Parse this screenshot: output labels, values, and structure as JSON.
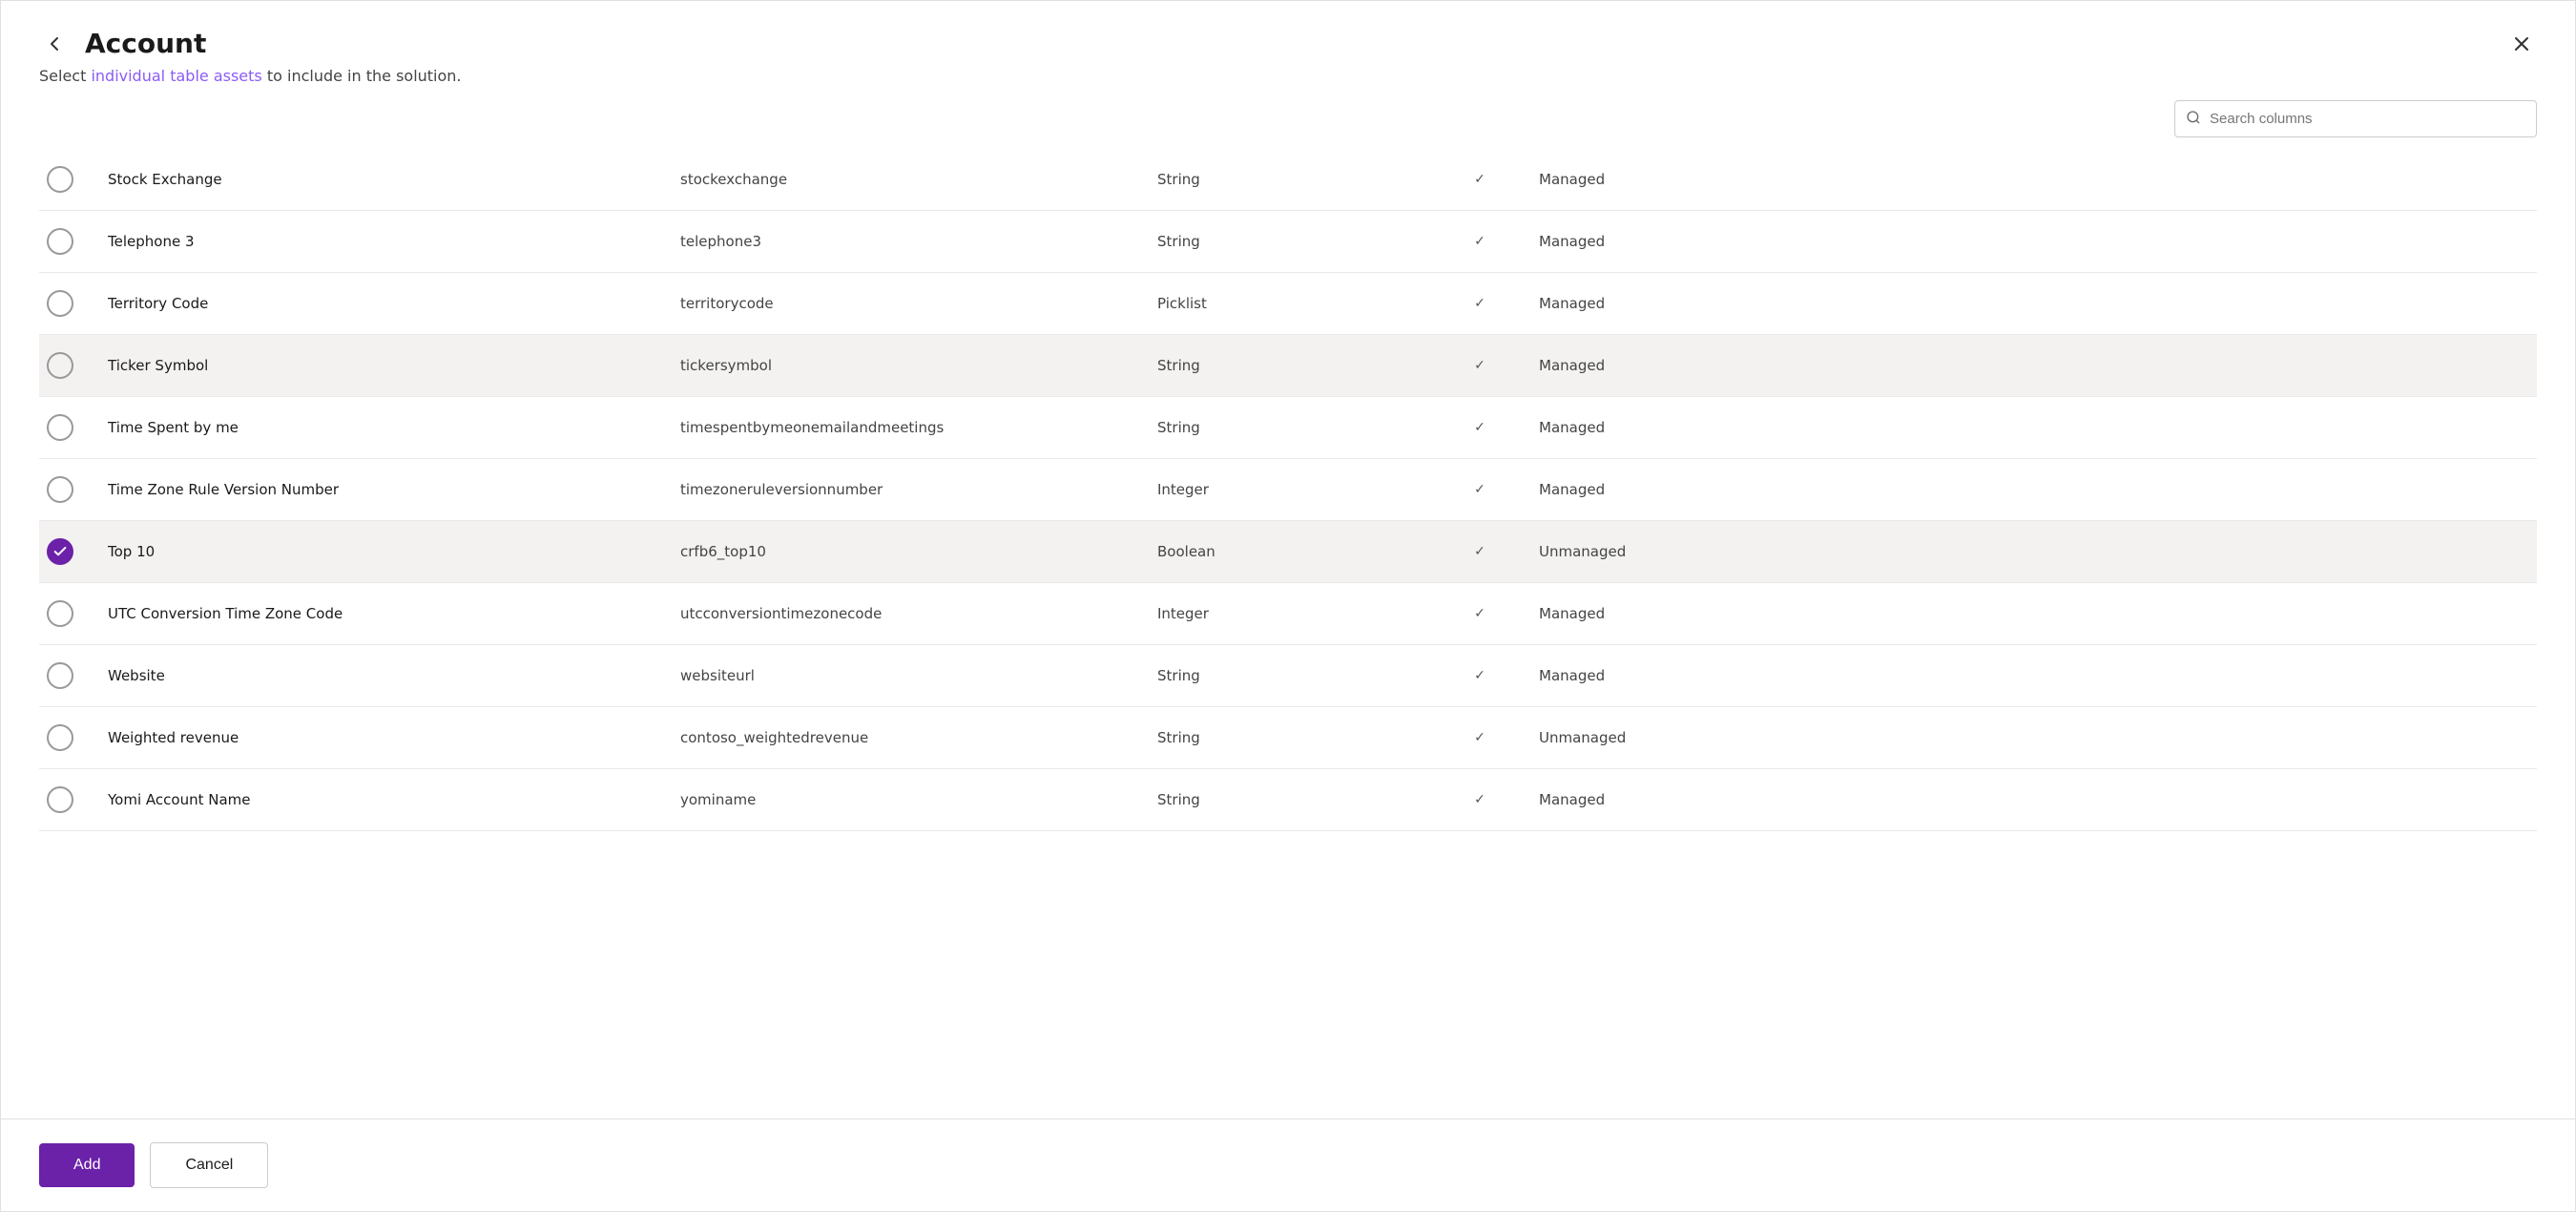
{
  "header": {
    "back_label": "back",
    "title": "Account",
    "close_label": "close"
  },
  "subtitle": {
    "text": "Select individual table assets to include in the solution.",
    "highlighted_words": [
      "individual",
      "table",
      "assets"
    ]
  },
  "search": {
    "placeholder": "Search columns"
  },
  "rows": [
    {
      "id": "stock-exchange",
      "name": "Stock Exchange",
      "logical": "stockexchange",
      "type": "String",
      "has_check": true,
      "managed": "Managed",
      "selected": false,
      "highlighted": false
    },
    {
      "id": "telephone3",
      "name": "Telephone 3",
      "logical": "telephone3",
      "type": "String",
      "has_check": true,
      "managed": "Managed",
      "selected": false,
      "highlighted": false
    },
    {
      "id": "territory-code",
      "name": "Territory Code",
      "logical": "territorycode",
      "type": "Picklist",
      "has_check": true,
      "managed": "Managed",
      "selected": false,
      "highlighted": false
    },
    {
      "id": "ticker-symbol",
      "name": "Ticker Symbol",
      "logical": "tickersymbol",
      "type": "String",
      "has_check": true,
      "managed": "Managed",
      "selected": false,
      "highlighted": true
    },
    {
      "id": "time-spent",
      "name": "Time Spent by me",
      "logical": "timespentbymeonemailandmeetings",
      "type": "String",
      "has_check": true,
      "managed": "Managed",
      "selected": false,
      "highlighted": false
    },
    {
      "id": "timezone-rule",
      "name": "Time Zone Rule Version Number",
      "logical": "timezoneruleversionnumber",
      "type": "Integer",
      "has_check": true,
      "managed": "Managed",
      "selected": false,
      "highlighted": false
    },
    {
      "id": "top10",
      "name": "Top 10",
      "logical": "crfb6_top10",
      "type": "Boolean",
      "has_check": true,
      "managed": "Unmanaged",
      "selected": true,
      "highlighted": true
    },
    {
      "id": "utc-conversion",
      "name": "UTC Conversion Time Zone Code",
      "logical": "utcconversiontimezonecode",
      "type": "Integer",
      "has_check": true,
      "managed": "Managed",
      "selected": false,
      "highlighted": false
    },
    {
      "id": "website",
      "name": "Website",
      "logical": "websiteurl",
      "type": "String",
      "has_check": true,
      "managed": "Managed",
      "selected": false,
      "highlighted": false
    },
    {
      "id": "weighted-revenue",
      "name": "Weighted revenue",
      "logical": "contoso_weightedrevenue",
      "type": "String",
      "has_check": true,
      "managed": "Unmanaged",
      "selected": false,
      "highlighted": false
    },
    {
      "id": "yomi-account",
      "name": "Yomi Account Name",
      "logical": "yominame",
      "type": "String",
      "has_check": true,
      "managed": "Managed",
      "selected": false,
      "highlighted": false
    }
  ],
  "footer": {
    "add_label": "Add",
    "cancel_label": "Cancel"
  }
}
